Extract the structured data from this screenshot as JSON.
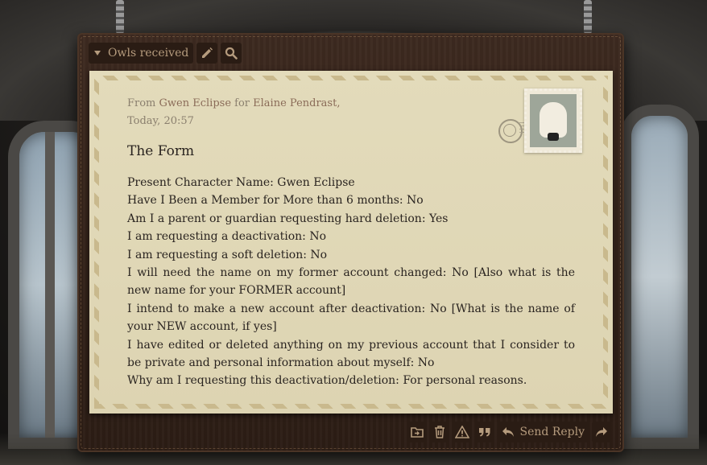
{
  "toolbar": {
    "folder_label": "Owls received",
    "icons": [
      "caret-down-icon",
      "pencil-icon",
      "search-icon"
    ]
  },
  "letter": {
    "from_prefix": "From",
    "sender": "Gwen Eclipse",
    "for_word": "for",
    "recipient": "Elaine Pendrast,",
    "timestamp": "Today, 20:57",
    "title": "The Form",
    "lines": [
      "Present Character Name: Gwen Eclipse",
      "Have I Been a Member for More than 6 months: No",
      "Am I a parent or guardian requesting hard deletion: Yes",
      "I am requesting a deactivation: No",
      "I am requesting a soft deletion: No",
      "I will need the name on my former account changed: No [Also what is the new name for your FORMER account]",
      "I intend to make a new account after deactivation: No [What is the name of your NEW account, if yes]",
      "I have edited or deleted anything on my previous account that I consider to be private and personal information about myself: No",
      "Why am I requesting this deactivation/deletion: For personal reasons."
    ]
  },
  "actions": {
    "send_reply_label": "Send Reply",
    "icons": [
      "move-to-folder-icon",
      "trash-icon",
      "warning-icon",
      "quote-icon",
      "reply-icon",
      "forward-icon"
    ]
  },
  "colors": {
    "board": "#34231a",
    "paper": "#e0d8b8",
    "button_bg": "#2a1c14",
    "button_fg": "#b59b7d",
    "sender_color": "#8a6b58"
  }
}
